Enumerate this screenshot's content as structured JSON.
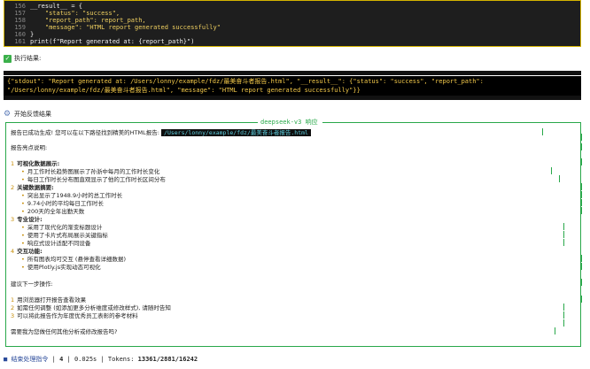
{
  "code": {
    "lines": [
      {
        "no": "156",
        "text": "__result__ = {"
      },
      {
        "no": "157",
        "text": "    \"status\": \"success\","
      },
      {
        "no": "158",
        "text": "    \"report_path\": report_path,"
      },
      {
        "no": "159",
        "text": "    \"message\": \"HTML report generated successfully\""
      },
      {
        "no": "160",
        "text": "}"
      },
      {
        "no": "161",
        "text": "print(f\"Report generated at: {report_path}\")"
      }
    ]
  },
  "exec": {
    "header": "执行结果:"
  },
  "output": {
    "line1": "{\"stdout\": \"Report generated at: /Users/lonny/example/fdz/最美奋斗者报告.html\", \"__result__\": {\"status\": \"success\", \"report_path\":",
    "line2": "\"/Users/lonny/example/fdz/最美奋斗者报告.html\", \"message\": \"HTML report generated successfully\"}}"
  },
  "feedback": {
    "header": "开始反馈结果",
    "panel_title": "deepseek-v3 响应",
    "intro": "报告已成功生成! 您可以在以下路径找到精美的HTML报告:",
    "path": "/Users/lonny/example/fdz/最美奋斗者报告.html",
    "highlights_title": "报告亮点说明:",
    "sections": [
      {
        "num": "1",
        "title": "可视化数据展示:",
        "items": [
          "月工作时长趋势图展示了孙浙中每月的工作时长变化",
          "每日工作时长分布图直观显示了他的工作时长区间分布"
        ]
      },
      {
        "num": "2",
        "title": "关键数据摘要:",
        "items": [
          "突出显示了1948.9小时的总工作时长",
          "9.74小时的平均每日工作时长",
          "200天的全年出勤天数"
        ]
      },
      {
        "num": "3",
        "title": "专业设计:",
        "items": [
          "采用了现代化的渐变标题设计",
          "使用了卡片式布局展示关键指标",
          "响应式设计适配不同设备"
        ]
      },
      {
        "num": "4",
        "title": "交互功能:",
        "items": [
          "所有图表均可交互 (悬停查看详细数据)",
          "使用Plotly.js实现动态可视化"
        ]
      }
    ],
    "next_title": "建议下一步操作:",
    "next_steps": [
      {
        "num": "1",
        "text": "用浏览器打开报告查看效果"
      },
      {
        "num": "2",
        "text": "如需任何调整 (如添加更多分析维度或修改样式), 请随时告知"
      },
      {
        "num": "3",
        "text": "可以将此报告作为年度优秀员工表彰的参考材料"
      }
    ],
    "question": "需要我为您做任何其他分析或修改报告吗?"
  },
  "footer": {
    "label": "结束处理指令",
    "count": "4",
    "time": "0.025s",
    "tokens_label": "Tokens:",
    "tokens": "13361/2881/16242"
  }
}
